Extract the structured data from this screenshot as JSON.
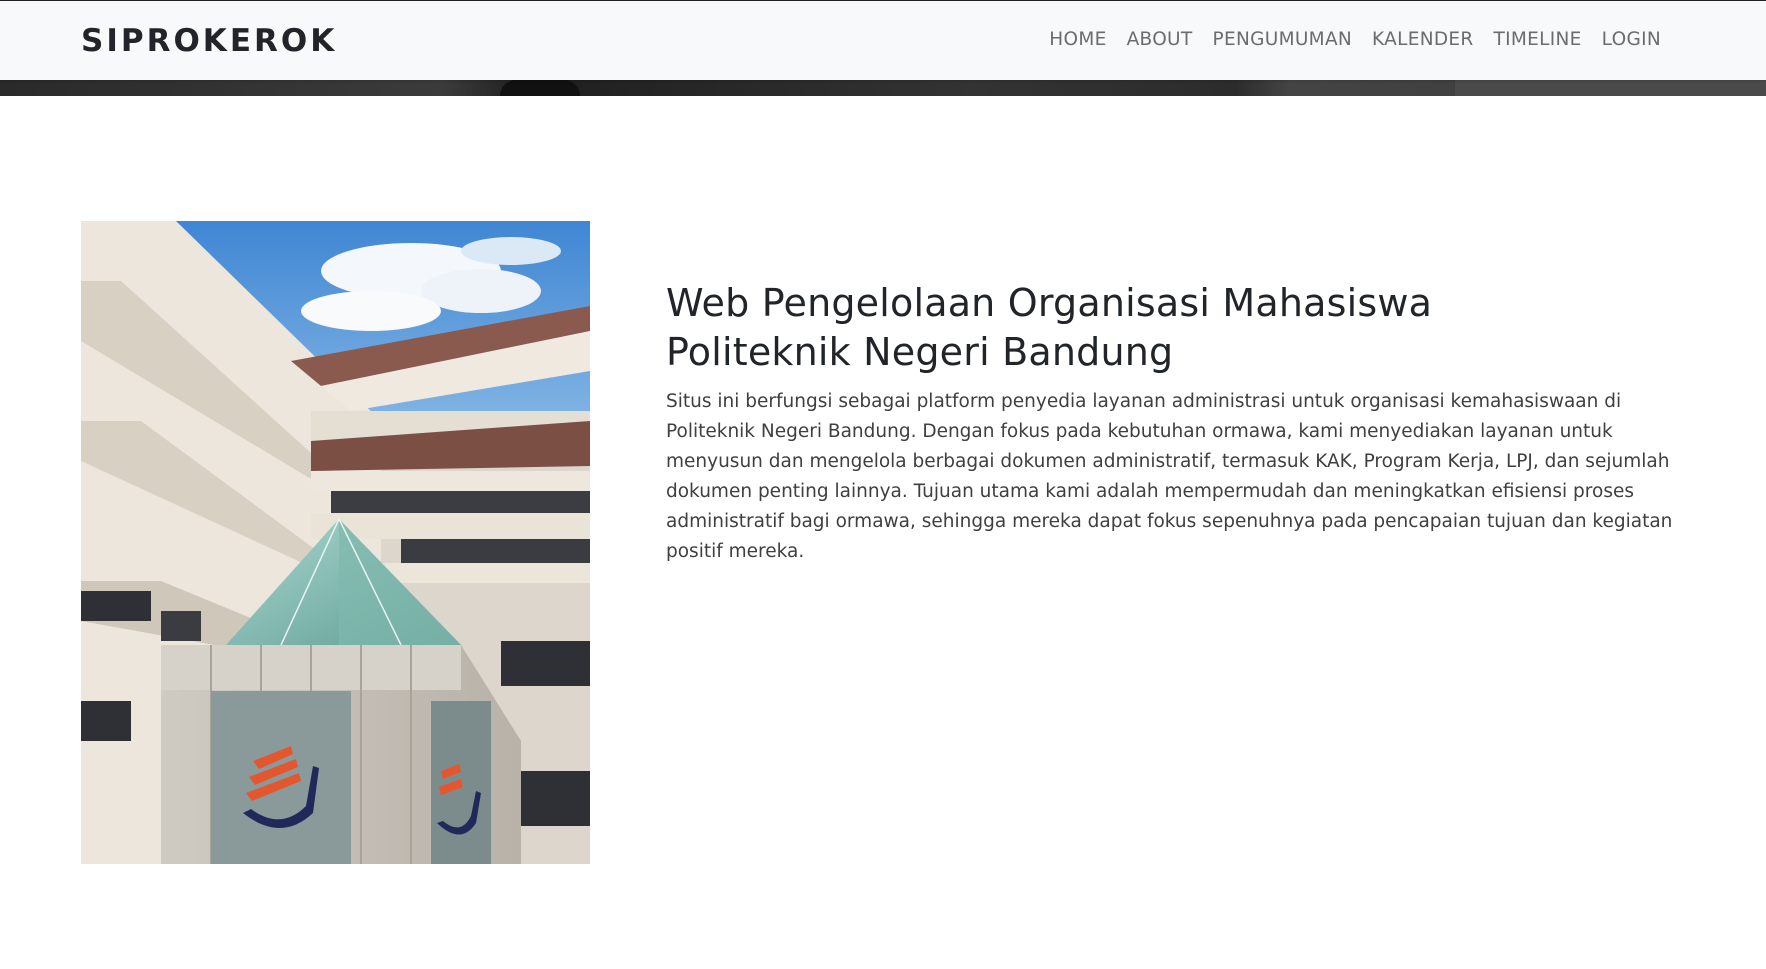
{
  "navbar": {
    "brand": "SIPROKEROK",
    "links": [
      "HOME",
      "ABOUT",
      "PENGUMUMAN",
      "KALENDER",
      "TIMELINE",
      "LOGIN"
    ]
  },
  "about": {
    "title_line1": "Web Pengelolaan Organisasi Mahasiswa",
    "title_line2": "Politeknik Negeri Bandung",
    "description": "Situs ini berfungsi sebagai platform penyedia layanan administrasi untuk organisasi kemahasiswaan di Politeknik Negeri Bandung. Dengan fokus pada kebutuhan ormawa, kami menyediakan layanan untuk menyusun dan mengelola berbagai dokumen administratif, termasuk KAK, Program Kerja, LPJ, dan sejumlah dokumen penting lainnya. Tujuan utama kami adalah mempermudah dan meningkatkan efisiensi proses administratif bagi ormawa, sehingga mereka dapat fokus sepenuhnya pada pencapaian tujuan dan kegiatan positif mereka."
  },
  "colors": {
    "navbar_bg": "#f8f9fa",
    "brand_text": "#212529",
    "nav_text": "#6c6c6c",
    "logo_orange": "#e4572e",
    "logo_navy": "#1f2a5a"
  }
}
